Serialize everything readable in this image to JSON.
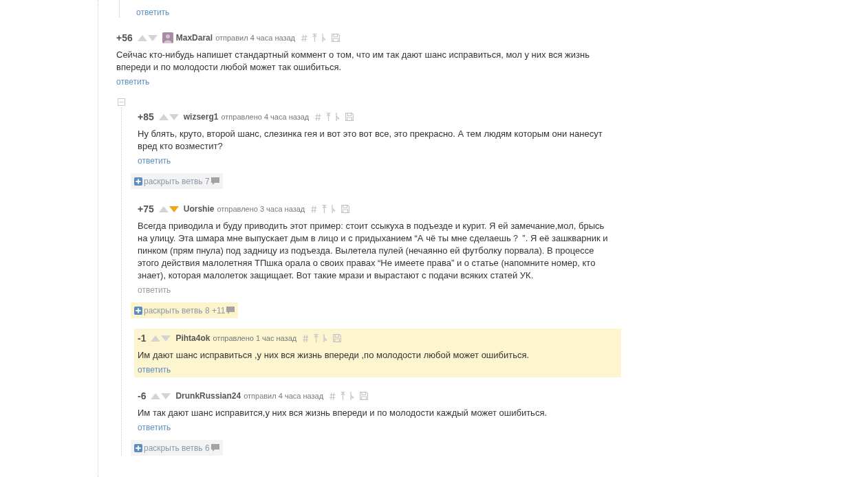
{
  "thread_tail": {
    "reply": "ответить"
  },
  "root_comment": {
    "rating": "+56",
    "upvoted": false,
    "downvoted": false,
    "has_avatar": true,
    "author": "MaxDaral",
    "meta": "отправил 4 часа назад",
    "text": "Сейчас кто-нибудь напишет стандартный коммент о том, что им так дают шанс исправиться, мол у них вся жизнь впереди и по молодости любой может так ошибиться.",
    "reply": "ответить",
    "reply_muted": false,
    "highlighted": false
  },
  "replies": [
    {
      "rating": "+85",
      "upvoted": false,
      "downvoted": false,
      "has_avatar": false,
      "author": "wizserg1",
      "meta": "отправлено 4 часа назад",
      "text": "Ну блять, круто, второй шанс, слезинка гея и вот это вот все, это прекрасно. А тем людям которым они нанесут вред кто возместит?",
      "reply": "ответить",
      "reply_muted": false,
      "highlighted": false,
      "expand": {
        "label": "раскрыть ветвь 7",
        "highlighted": false
      }
    },
    {
      "rating": "+75",
      "upvoted": false,
      "downvoted": true,
      "has_avatar": false,
      "author": "Uorshie",
      "meta": "отправлено 3 часа назад",
      "text": "Всегда приводила и буду приводить этот пример: стоит ссыкуха в подъезде и курит. Я ей замечание,мол, брысь на улицу. Эта шмара мне выпускает дым в лицо и с придыханием “А чё ты мне сделаешь？ ”. Я её зашкварник и пинком (прям пнула) под задницу из подъезда. Вылетела пулей (нечаянно ей футболку порвала). В процессе этого действия малолетняя ТПшка орала о своих правах “Не имеете права” и о статье (напомните номер, кто знает), которая малолеток защищает. Вот такие мрази и вырастают с подачи всяких статей УК.",
      "reply": "ответить",
      "reply_muted": true,
      "highlighted": false,
      "expand": {
        "label": "раскрыть ветвь 8 +11",
        "highlighted": true
      }
    },
    {
      "rating": "-1",
      "upvoted": false,
      "downvoted": false,
      "has_avatar": false,
      "author": "Pihta4ok",
      "meta": "отправлено 1 час назад",
      "text": "Им дают шанс исправиться ,у них вся жизнь впереди ,по молодости любой может ошибиться.",
      "reply": "ответить",
      "reply_muted": false,
      "highlighted": true
    },
    {
      "rating": "-6",
      "upvoted": false,
      "downvoted": false,
      "has_avatar": false,
      "author": "DrunkRussian24",
      "meta": "отправил 4 часа назад",
      "text": "Им так дают шанс исправится,у них вся жизнь впереди и по молодости каждый может ошибиться.",
      "reply": "ответить",
      "reply_muted": false,
      "highlighted": false,
      "expand": {
        "label": "раскрыть ветвь 6",
        "highlighted": false
      }
    }
  ]
}
